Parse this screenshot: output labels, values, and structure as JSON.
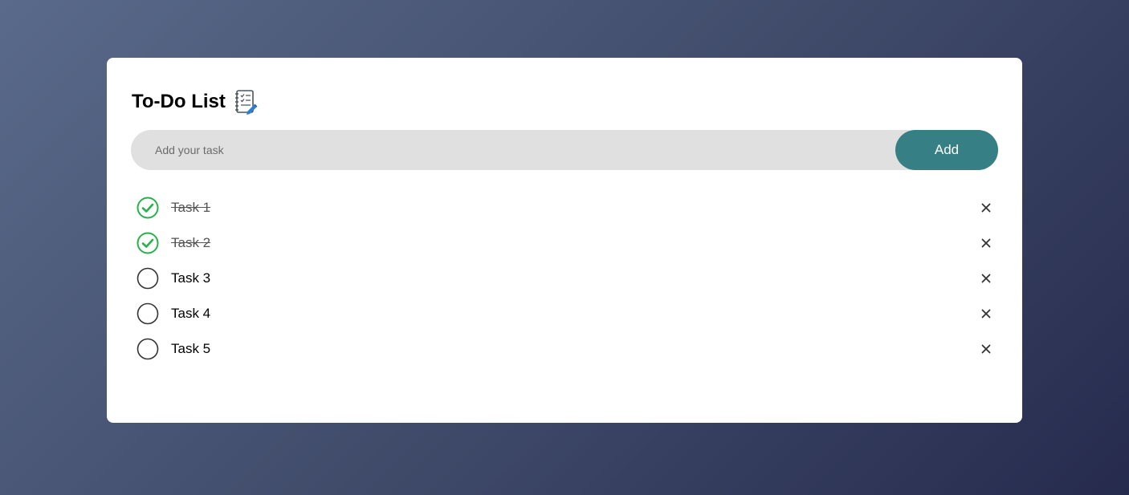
{
  "app": {
    "title": "To-Do List",
    "title_icon": "notebook-checklist-icon"
  },
  "input": {
    "placeholder": "Add your task",
    "value": "",
    "add_label": "Add"
  },
  "colors": {
    "accent": "#367f84",
    "check_green": "#27b24a",
    "input_bg": "#e0e0e0"
  },
  "tasks": [
    {
      "label": "Task 1",
      "done": true
    },
    {
      "label": "Task 2",
      "done": true
    },
    {
      "label": "Task 3",
      "done": false
    },
    {
      "label": "Task 4",
      "done": false
    },
    {
      "label": "Task 5",
      "done": false
    }
  ]
}
